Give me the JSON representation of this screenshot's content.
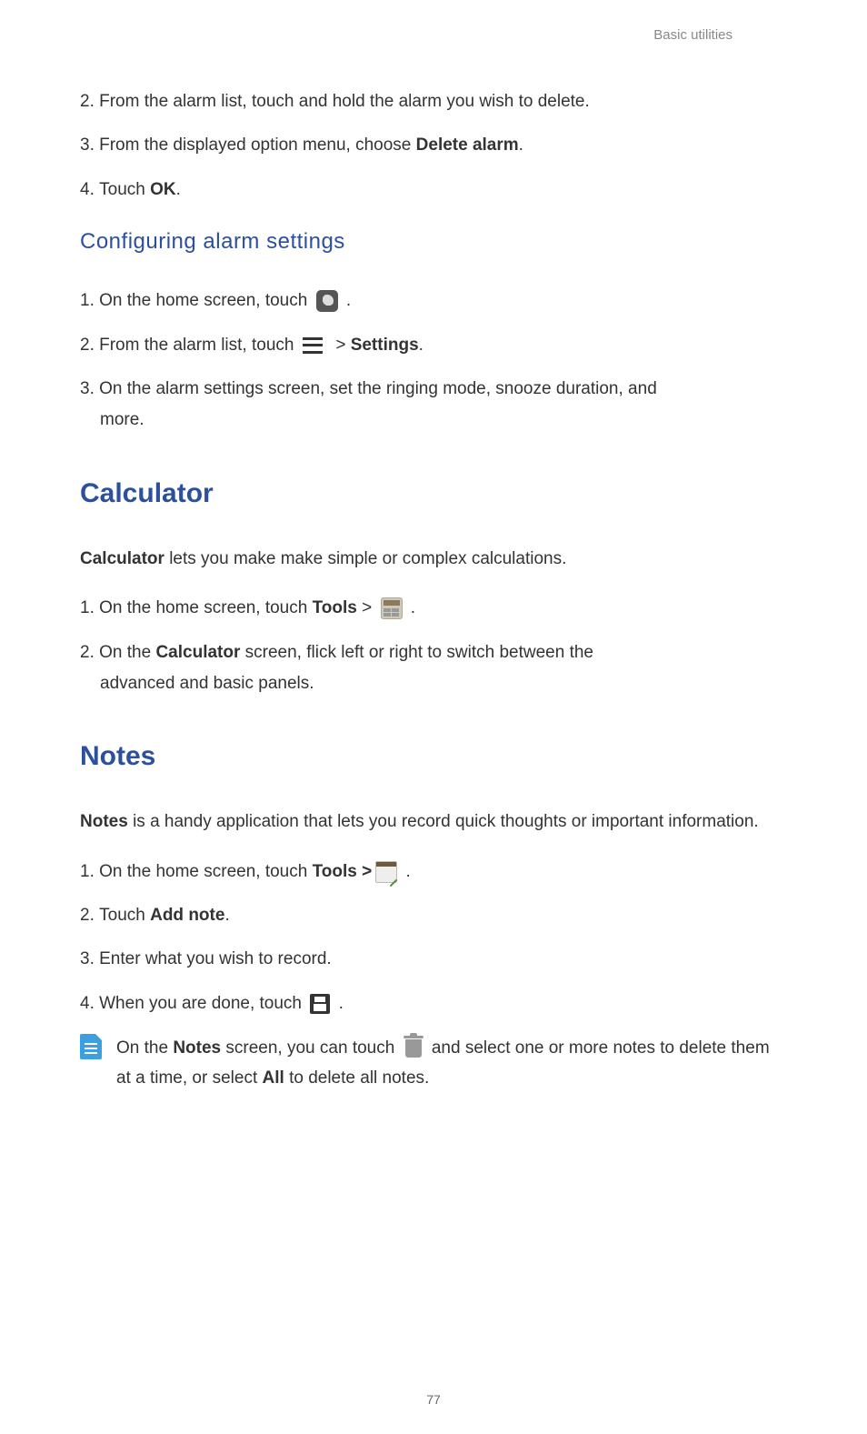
{
  "header": {
    "section_label": "Basic utilities"
  },
  "deleteAlarm": {
    "step2": {
      "num": "2. ",
      "text": "From the alarm list, touch and hold the alarm you wish to delete."
    },
    "step3": {
      "num": "3. ",
      "text": "From the displayed option menu, choose ",
      "bold": "Delete alarm",
      "tail": "."
    },
    "step4": {
      "num": "4. ",
      "text": "Touch ",
      "bold": "OK",
      "tail": "."
    }
  },
  "configuring": {
    "heading": "Configuring alarm settings",
    "step1": {
      "num": "1. ",
      "text": "On the home screen, touch ",
      "tail": " ."
    },
    "step2": {
      "num": "2. ",
      "text": "From the alarm list, touch ",
      "mid": "  > ",
      "bold": "Settings",
      "tail": "."
    },
    "step3": {
      "num": "3. ",
      "text": "On the alarm settings screen, set the ringing mode, snooze duration, and",
      "cont": "more."
    }
  },
  "calculator": {
    "heading": "Calculator",
    "intro_bold": "Calculator",
    "intro_rest": " lets you make make simple or complex calculations.",
    "step1": {
      "num": "1. ",
      "text": "On the home screen, touch ",
      "bold": "Tools",
      "mid": " > ",
      "tail": " ."
    },
    "step2": {
      "num": "2. ",
      "text1": "On the ",
      "bold": "Calculator",
      "text2": " screen, flick left or right to switch between the",
      "cont": "advanced and basic panels."
    }
  },
  "notes": {
    "heading": "Notes",
    "intro_bold": "Notes",
    "intro_rest": " is a handy application that lets you record quick thoughts or important information.",
    "step1": {
      "num": "1. ",
      "text": "On the home screen, touch ",
      "bold": "Tools > ",
      "tail": " ."
    },
    "step2": {
      "num": "2. ",
      "text": "Touch ",
      "bold": "Add note",
      "tail": "."
    },
    "step3": {
      "num": "3. ",
      "text": "Enter what you wish to record."
    },
    "step4": {
      "num": "4. ",
      "text": "When you are done, touch ",
      "tail": " ."
    },
    "tip": {
      "pre": "On the ",
      "bold1": "Notes",
      "mid1": " screen, you can touch ",
      "mid2": " and select one or more notes to delete them at a time, or select ",
      "bold2": "All",
      "tail": " to delete all notes."
    }
  },
  "page_number": "77"
}
